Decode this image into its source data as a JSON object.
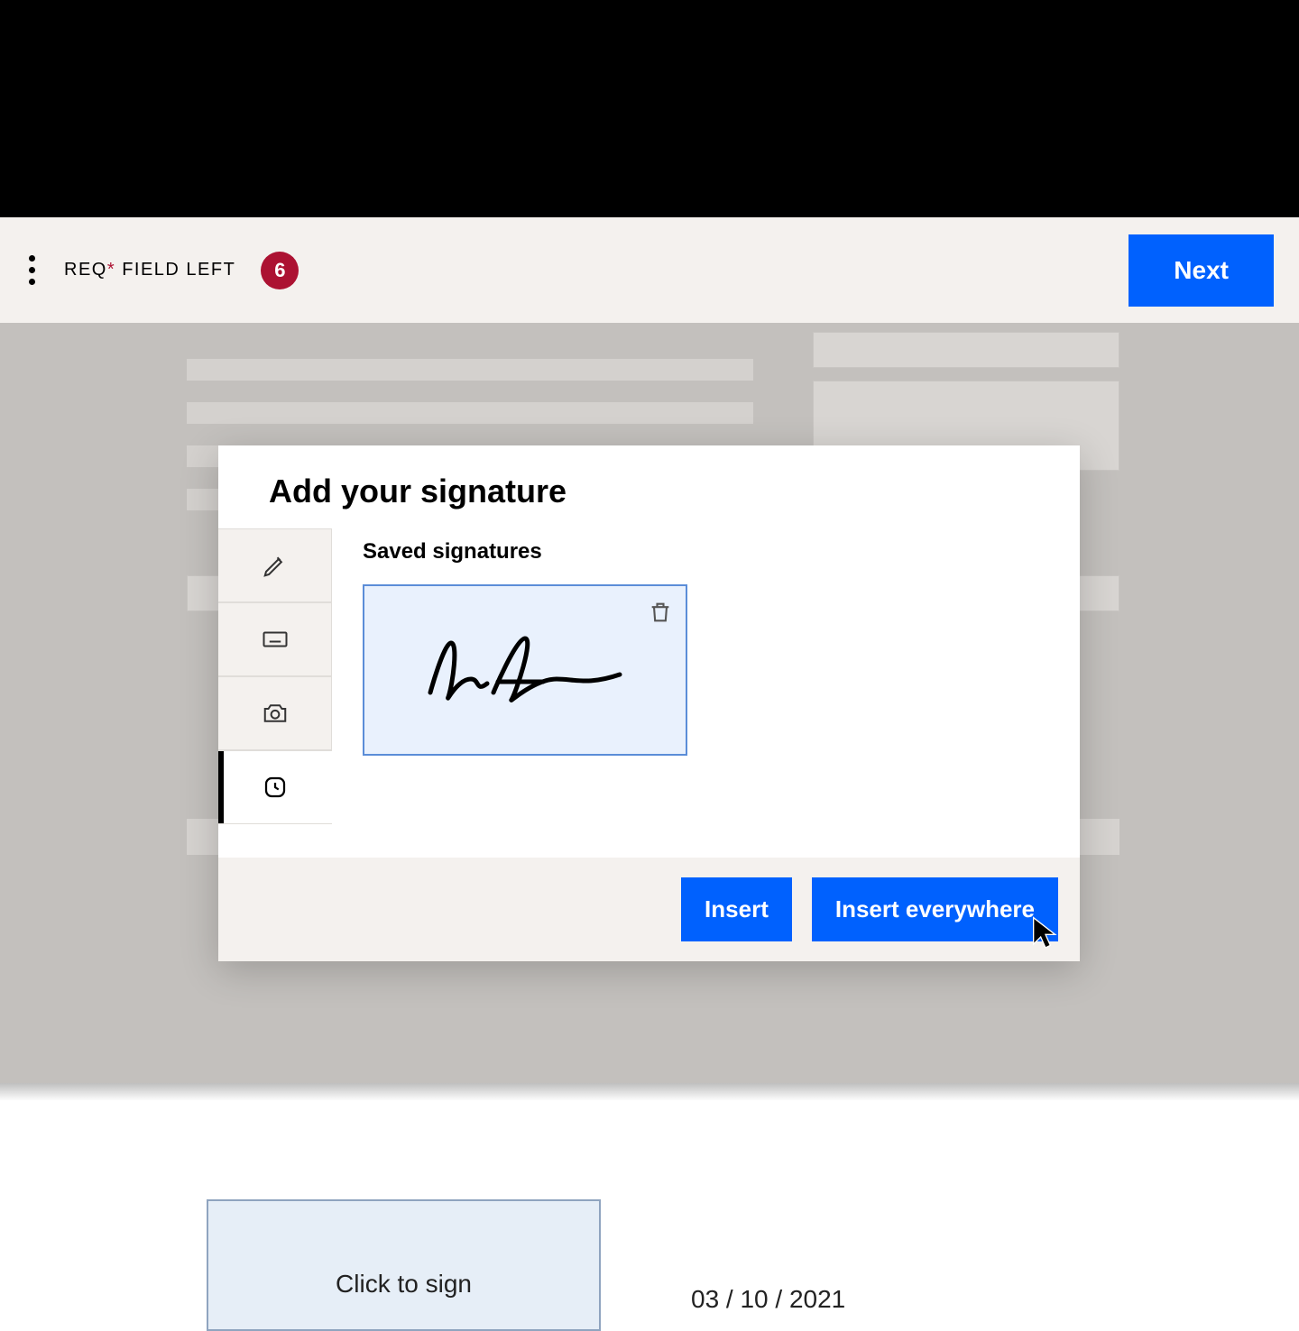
{
  "toolbar": {
    "req_prefix": "REQ",
    "req_asterisk": "*",
    "req_suffix": " FIELD LEFT",
    "badge_count": "6",
    "next_label": "Next"
  },
  "sign_box": {
    "placeholder": "Click to sign"
  },
  "date_value": "03 / 10 / 2021",
  "modal": {
    "title": "Add your signature",
    "subhead": "Saved signatures",
    "tabs": {
      "draw": "pencil-icon",
      "type": "keyboard-icon",
      "image": "camera-icon",
      "saved": "clock-icon"
    },
    "active_tab": "saved",
    "insert_label": "Insert",
    "insert_everywhere_label": "Insert everywhere"
  }
}
